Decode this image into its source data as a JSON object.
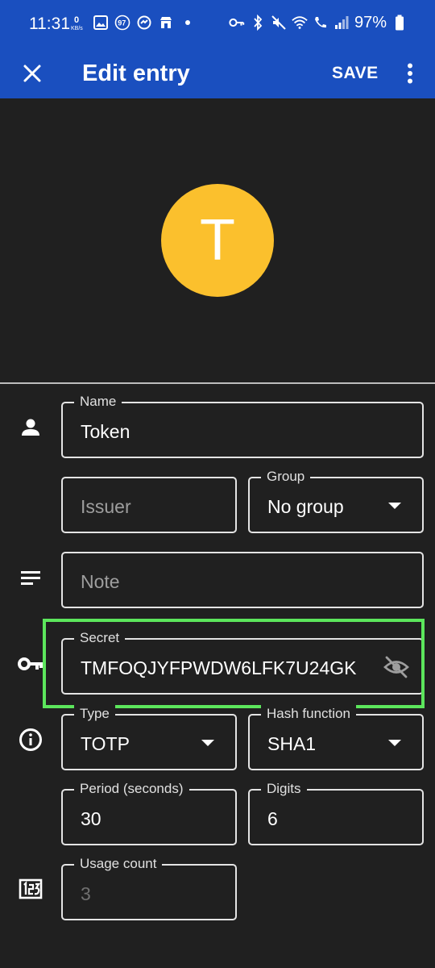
{
  "status_bar": {
    "time": "11:31",
    "battery": "97%"
  },
  "app_bar": {
    "title": "Edit entry",
    "save_label": "SAVE"
  },
  "avatar": {
    "letter": "T",
    "color": "#fbc02d"
  },
  "fields": {
    "name": {
      "label": "Name",
      "value": "Token"
    },
    "issuer": {
      "placeholder": "Issuer"
    },
    "group": {
      "label": "Group",
      "value": "No group"
    },
    "note": {
      "placeholder": "Note"
    },
    "secret": {
      "label": "Secret",
      "value": "TMFOQJYFPWDW6LFK7U24GK"
    },
    "type": {
      "label": "Type",
      "value": "TOTP"
    },
    "hash_function": {
      "label": "Hash function",
      "value": "SHA1"
    },
    "period": {
      "label": "Period (seconds)",
      "value": "30"
    },
    "digits": {
      "label": "Digits",
      "value": "6"
    },
    "usage_count": {
      "label": "Usage count",
      "value": "3"
    }
  },
  "colors": {
    "app_bar": "#1a4fbf",
    "background": "#202020",
    "highlight": "#5ce65c"
  }
}
